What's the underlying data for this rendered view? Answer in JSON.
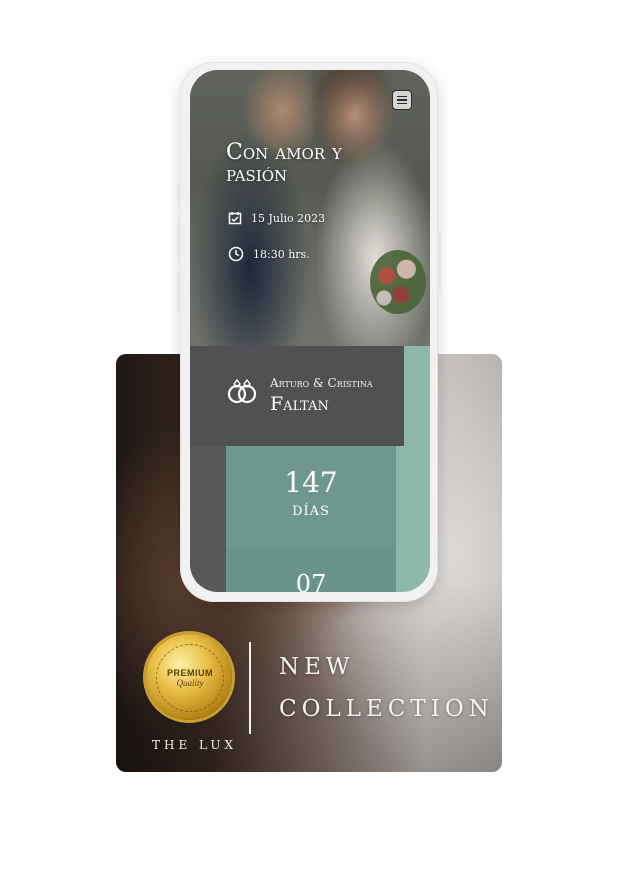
{
  "promo": {
    "seal_line1": "PREMIUM",
    "seal_line2": "Quality",
    "brand": "THE LUX",
    "collection_line1": "NEW",
    "collection_line2": "COLLECTION"
  },
  "invitation": {
    "title": "Con amor y pasión",
    "date": "15 Julio 2023",
    "time": "18:30 hrs.",
    "couple": "Arturo & Cristina",
    "countdown_heading": "Faltan",
    "days_value": "147",
    "days_label": "DÍAS",
    "hours_value": "07"
  },
  "icons": {
    "menu": "menu-icon",
    "calendar": "calendar-check-icon",
    "clock": "clock-icon",
    "rings": "wedding-rings-icon"
  },
  "colors": {
    "accent_teal": "#8fb8ad",
    "countdown_teal": "#6e978d",
    "panel_dark": "#515052"
  }
}
